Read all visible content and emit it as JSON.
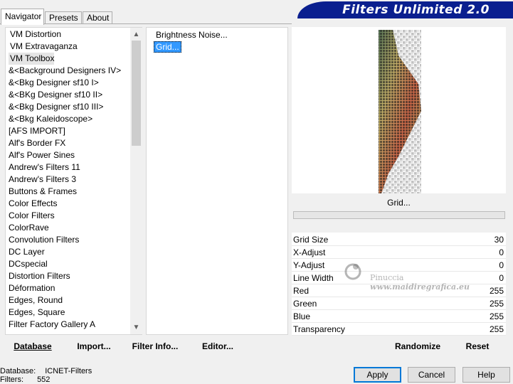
{
  "tabs": [
    {
      "label": "Navigator",
      "active": true
    },
    {
      "label": "Presets",
      "active": false
    },
    {
      "label": "About",
      "active": false
    }
  ],
  "banner": {
    "title": "Filters Unlimited 2.0",
    "color": "#0a1f8f"
  },
  "categories": [
    "VM Distortion",
    "VM Extravaganza",
    "VM Toolbox",
    "&<Background Designers IV>",
    "&<Bkg Designer sf10 I>",
    "&<BKg Designer sf10 II>",
    "&<Bkg Designer sf10 III>",
    "&<Bkg Kaleidoscope>",
    "[AFS IMPORT]",
    "Alf's Border FX",
    "Alf's Power Sines",
    "Andrew's Filters 11",
    "Andrew's Filters 3",
    "Buttons & Frames",
    "Color Effects",
    "Color Filters",
    "ColorRave",
    "Convolution Filters",
    "DC Layer",
    "DCspecial",
    "Distortion Filters",
    "Déformation",
    "Edges, Round",
    "Edges, Square",
    "Filter Factory Gallery A"
  ],
  "filters": [
    {
      "label": "Brightness Noise...",
      "selected": false
    },
    {
      "label": "Grid...",
      "selected": true
    }
  ],
  "left_buttons": {
    "database": "Database",
    "import": "Import...",
    "filter_info": "Filter Info...",
    "editor": "Editor..."
  },
  "preview": {
    "filter_button": "Grid..."
  },
  "params": [
    {
      "label": "Grid Size",
      "value": "30"
    },
    {
      "label": "X-Adjust",
      "value": "0"
    },
    {
      "label": "Y-Adjust",
      "value": "0"
    },
    {
      "label": "Line Width",
      "value": "0"
    },
    {
      "label": "Red",
      "value": "255"
    },
    {
      "label": "Green",
      "value": "255"
    },
    {
      "label": "Blue",
      "value": "255"
    },
    {
      "label": "Transparency",
      "value": "255"
    }
  ],
  "right_buttons": {
    "randomize": "Randomize",
    "reset": "Reset"
  },
  "footer": {
    "database_label": "Database:",
    "database_value": "ICNET-Filters",
    "filters_label": "Filters:",
    "filters_value": "552"
  },
  "dialog_buttons": {
    "apply": "Apply",
    "cancel": "Cancel",
    "help": "Help"
  },
  "watermark": {
    "line1": "Pinuccia",
    "line2": "www.maidiregrafica.eu"
  }
}
